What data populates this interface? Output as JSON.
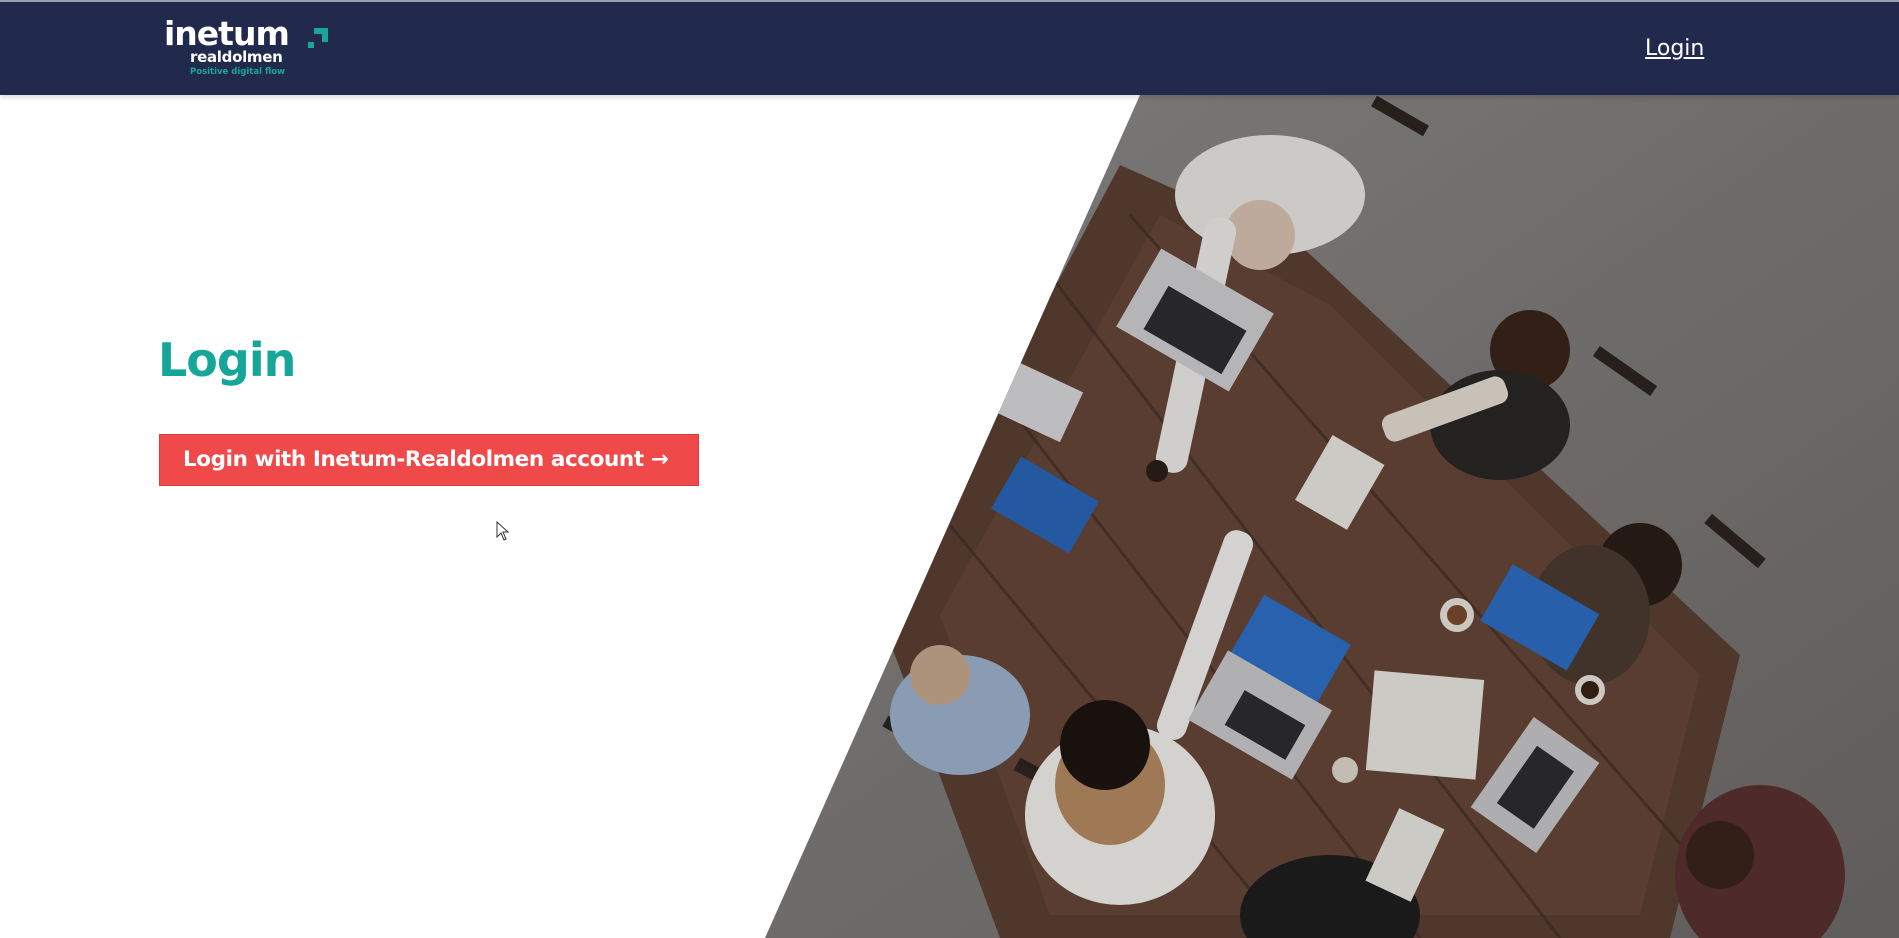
{
  "header": {
    "logo": {
      "brand": "inetum",
      "sub": "realdolmen",
      "tagline": "Positive digital flow",
      "accent_color": "#1aa69a"
    },
    "nav_login_label": "Login",
    "background_color": "#212a4c"
  },
  "main": {
    "title": "Login",
    "title_color": "#14a699",
    "login_button_label": "Login with Inetum-Realdolmen account →",
    "login_button_color": "#ef4949",
    "hero_image": "team-meeting-overhead-photo"
  },
  "icons": {
    "cursor": "mouse-pointer-icon"
  }
}
